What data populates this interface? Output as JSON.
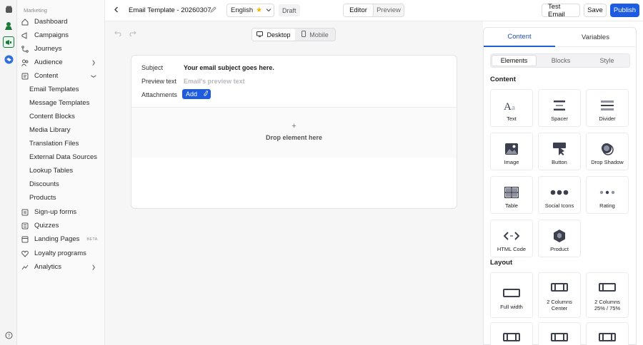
{
  "sidebar": {
    "section_title": "Marketing",
    "items": [
      {
        "label": "Dashboard"
      },
      {
        "label": "Campaigns"
      },
      {
        "label": "Journeys"
      },
      {
        "label": "Audience"
      },
      {
        "label": "Content"
      },
      {
        "label": "Email Templates"
      },
      {
        "label": "Message Templates"
      },
      {
        "label": "Content Blocks"
      },
      {
        "label": "Media Library"
      },
      {
        "label": "Translation Files"
      },
      {
        "label": "External Data Sources"
      },
      {
        "label": "Lookup Tables"
      },
      {
        "label": "Discounts"
      },
      {
        "label": "Products"
      },
      {
        "label": "Sign-up forms"
      },
      {
        "label": "Quizzes"
      },
      {
        "label": "Landing Pages"
      },
      {
        "label": "Loyalty programs"
      },
      {
        "label": "Analytics"
      }
    ],
    "beta_badge": "BETA"
  },
  "topbar": {
    "template_title": "Email Template - 20260307",
    "language": "English",
    "status": "Draft",
    "editor_tab": "Editor",
    "preview_tab": "Preview",
    "test_email": "Test Email",
    "save": "Save",
    "publish": "Publish"
  },
  "canvas": {
    "desktop": "Desktop",
    "mobile": "Mobile",
    "subject_label": "Subject",
    "subject_value": "Your email subject goes here.",
    "preview_label": "Preview text",
    "preview_placeholder": "Email's preview text",
    "attachments_label": "Attachments",
    "add_label": "Add",
    "drop_text": "Drop element here"
  },
  "panel": {
    "tabs": [
      "Content",
      "Variables"
    ],
    "subtabs": [
      "Elements",
      "Blocks",
      "Style"
    ],
    "content_heading": "Content",
    "layout_heading": "Layout",
    "elements": [
      {
        "label": "Text",
        "icon": "text-icon"
      },
      {
        "label": "Spacer",
        "icon": "spacer-icon"
      },
      {
        "label": "Divider",
        "icon": "divider-icon"
      },
      {
        "label": "Image",
        "icon": "image-icon"
      },
      {
        "label": "Button",
        "icon": "button-icon"
      },
      {
        "label": "Drop Shadow",
        "icon": "drop-shadow-icon"
      },
      {
        "label": "Table",
        "icon": "table-icon"
      },
      {
        "label": "Social Icons",
        "icon": "social-icons-icon"
      },
      {
        "label": "Rating",
        "icon": "rating-icon"
      },
      {
        "label": "HTML Code",
        "icon": "html-code-icon"
      },
      {
        "label": "Product",
        "icon": "product-icon"
      }
    ],
    "layouts": [
      {
        "label": "Full width"
      },
      {
        "label": "2 Columns Center"
      },
      {
        "label": "2 Columns 25% / 75%"
      }
    ]
  },
  "colors": {
    "accent": "#1f5fd6",
    "publish_bg": "#1d5ce0",
    "star": "#f5b400",
    "active_tab_text": "#1f4fb5"
  }
}
